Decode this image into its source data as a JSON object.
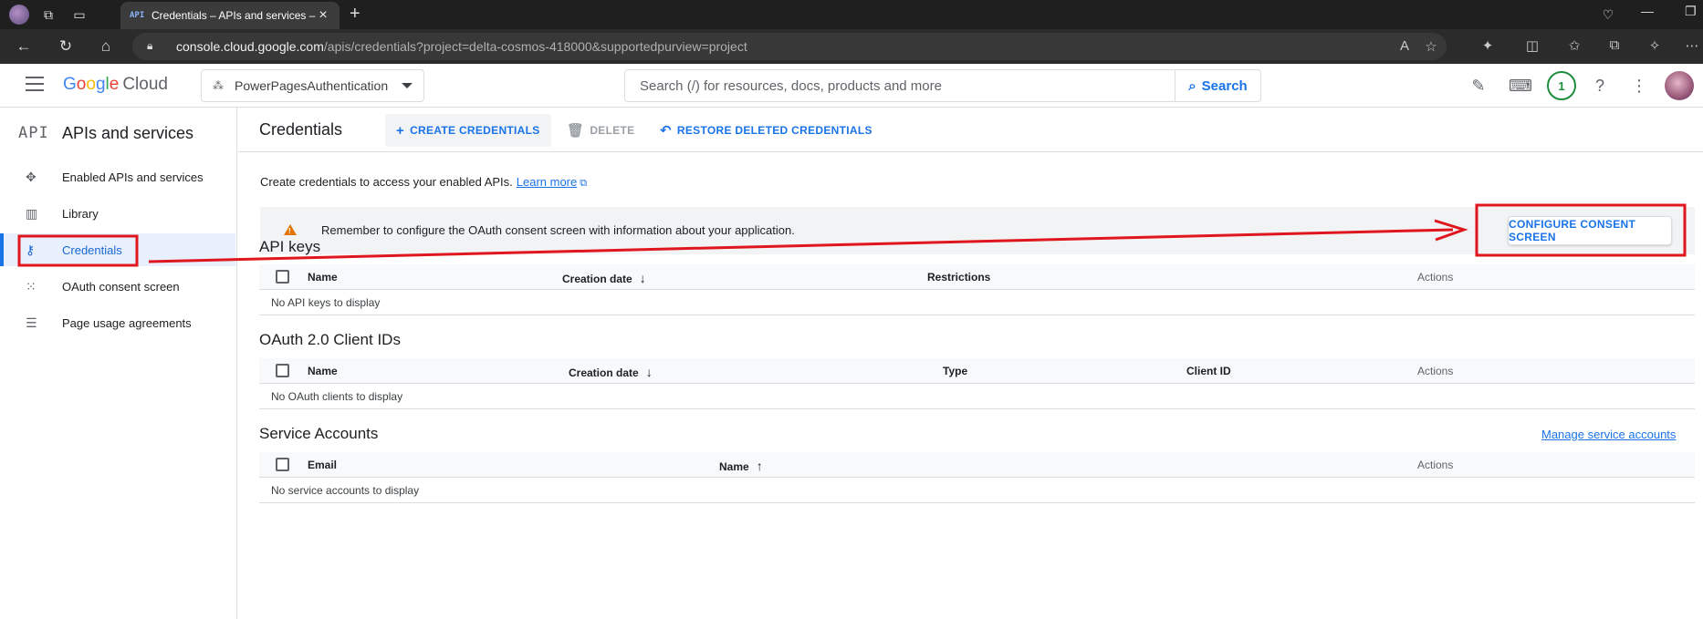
{
  "browser": {
    "tab_title": "Credentials – APIs and services –",
    "tab_favicon": "API",
    "url_host": "console.cloud.google.com",
    "url_path": "/apis/credentials?project=delta-cosmos-418000&supportedpurview=project"
  },
  "header": {
    "logo_google": [
      "G",
      "o",
      "o",
      "g",
      "l",
      "e"
    ],
    "logo_cloud": "Cloud",
    "project_name": "PowerPagesAuthentication",
    "search_placeholder": "Search (/) for resources, docs, products and more",
    "search_button": "Search",
    "notification_count": "1"
  },
  "sidebar": {
    "api_glyph": "API",
    "title": "APIs and services",
    "items": [
      {
        "label": "Enabled APIs and services",
        "icon": "enabled-apis-icon"
      },
      {
        "label": "Library",
        "icon": "library-icon"
      },
      {
        "label": "Credentials",
        "icon": "key-icon"
      },
      {
        "label": "OAuth consent screen",
        "icon": "consent-icon"
      },
      {
        "label": "Page usage agreements",
        "icon": "settings-list-icon"
      }
    ]
  },
  "toolbar": {
    "title": "Credentials",
    "create_label": "CREATE CREDENTIALS",
    "delete_label": "DELETE",
    "restore_label": "RESTORE DELETED CREDENTIALS"
  },
  "content": {
    "intro_text": "Create credentials to access your enabled APIs.",
    "learn_more": "Learn more",
    "banner_text": "Remember to configure the OAuth consent screen with information about your application.",
    "configure_button": "CONFIGURE CONSENT SCREEN",
    "api_keys": {
      "title": "API keys",
      "columns": [
        "Name",
        "Creation date",
        "Restrictions",
        "Actions"
      ],
      "empty": "No API keys to display"
    },
    "oauth_clients": {
      "title": "OAuth 2.0 Client IDs",
      "columns": [
        "Name",
        "Creation date",
        "Type",
        "Client ID",
        "Actions"
      ],
      "empty": "No OAuth clients to display"
    },
    "service_accounts": {
      "title": "Service Accounts",
      "manage_link": "Manage service accounts",
      "columns": [
        "Email",
        "Name",
        "Actions"
      ],
      "empty": "No service accounts to display"
    }
  },
  "colors": {
    "accent": "#1a73e8",
    "annotation": "#e0161e",
    "warning": "#e37400"
  }
}
